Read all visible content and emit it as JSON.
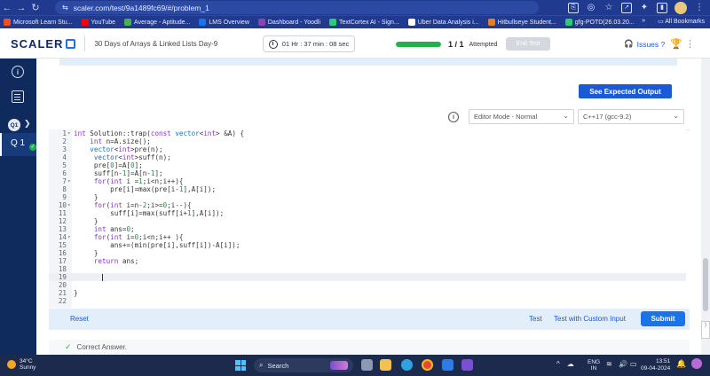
{
  "browser": {
    "url_prefix": "⇆",
    "url": "scaler.com/test/9a1489fc69/#/problem_1",
    "bookmarks": [
      {
        "label": "Microsoft Learn Stu...",
        "color": "#f25022"
      },
      {
        "label": "YouTube",
        "color": "#ff0000"
      },
      {
        "label": "Average - Aptitude...",
        "color": "#4caf50"
      },
      {
        "label": "LMS Overview",
        "color": "#1a73e8"
      },
      {
        "label": "Dashboard - Yoodli",
        "color": "#8e44ad"
      },
      {
        "label": "TextCortex AI - Sign...",
        "color": "#2ecc71"
      },
      {
        "label": "Uber Data Analysis i...",
        "color": "#ffffff"
      },
      {
        "label": "Hitbullseye Student...",
        "color": "#e67e22"
      },
      {
        "label": "gfg-POTD(26.03.20...",
        "color": "#2ecc71"
      }
    ],
    "bookmarks_more": "»",
    "all_bookmarks": "All Bookmarks"
  },
  "header": {
    "logo": "SCALER",
    "contest_title": "30 Days of Arrays & Linked Lists Day-9",
    "timer": "01 Hr : 37 min : 08 sec",
    "progress_fraction": 1.0,
    "attempts": "1 / 1",
    "attempted_label": "Attempted",
    "end_test": "End Test",
    "issues": "Issues ?"
  },
  "rail": {
    "info_icon": "i",
    "question_badge": "Q1",
    "question_label": "Q 1",
    "question_chevron": "❯"
  },
  "editor": {
    "see_expected_output": "See Expected Output",
    "mode": "Editor Mode - Normal",
    "language": "C++17 (gcc-9.2)",
    "lines": [
      {
        "n": "1",
        "fold": true,
        "code": "int Solution::trap(const vector<int> &A) {"
      },
      {
        "n": "2",
        "fold": false,
        "code": "    int n=A.size();"
      },
      {
        "n": "3",
        "fold": false,
        "code": "    vector<int>pre(n);"
      },
      {
        "n": "4",
        "fold": false,
        "code": "     vector<int>suff(n);"
      },
      {
        "n": "5",
        "fold": false,
        "code": "     pre[0]=A[0];"
      },
      {
        "n": "6",
        "fold": false,
        "code": "     suff[n-1]=A[n-1];"
      },
      {
        "n": "7",
        "fold": true,
        "code": "     for(int i =1;i<n;i++){"
      },
      {
        "n": "8",
        "fold": false,
        "code": "         pre[i]=max(pre[i-1],A[i]);"
      },
      {
        "n": "9",
        "fold": false,
        "code": "     }"
      },
      {
        "n": "10",
        "fold": true,
        "code": "     for(int i=n-2;i>=0;i--){"
      },
      {
        "n": "11",
        "fold": false,
        "code": "         suff[i]=max(suff[i+1],A[i]);"
      },
      {
        "n": "12",
        "fold": false,
        "code": "     }"
      },
      {
        "n": "13",
        "fold": false,
        "code": "     int ans=0;"
      },
      {
        "n": "14",
        "fold": true,
        "code": "     for(int i=0;i<n;i++ ){"
      },
      {
        "n": "15",
        "fold": false,
        "code": "         ans+=(min(pre[i],suff[i])-A[i]);"
      },
      {
        "n": "16",
        "fold": false,
        "code": "     }"
      },
      {
        "n": "17",
        "fold": false,
        "code": "     return ans;"
      },
      {
        "n": "18",
        "fold": false,
        "code": ""
      },
      {
        "n": "19",
        "fold": false,
        "code": ""
      },
      {
        "n": "20",
        "fold": false,
        "code": ""
      },
      {
        "n": "21",
        "fold": false,
        "code": "}"
      },
      {
        "n": "22",
        "fold": false,
        "code": ""
      }
    ],
    "active_line": 19
  },
  "footer": {
    "reset": "Reset",
    "test": "Test",
    "test_custom": "Test with Custom Input",
    "submit": "Submit"
  },
  "result": {
    "icon": "✓",
    "text": "Correct Answer."
  },
  "taskbar": {
    "temperature": "34°C",
    "weather": "Sunny",
    "search": "Search",
    "lang_top": "ENG",
    "lang_bottom": "IN",
    "time": "13:51",
    "date": "09-04-2024"
  }
}
